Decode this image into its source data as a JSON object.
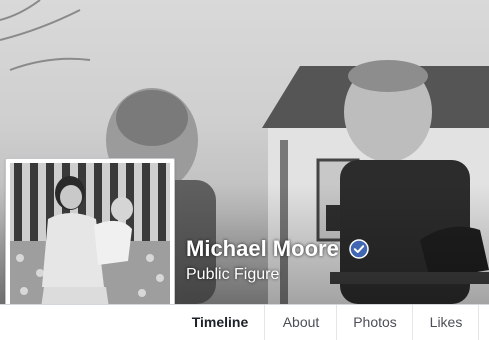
{
  "page": {
    "name": "Michael Moore",
    "category": "Public Figure",
    "verified": true,
    "accent_color": "#4267b2"
  },
  "cover": {
    "description_icon": "cover-photo-image"
  },
  "profile_picture": {
    "icon": "profile-photo-image"
  },
  "tabs": [
    {
      "label": "Timeline",
      "active": true
    },
    {
      "label": "About",
      "active": false
    },
    {
      "label": "Photos",
      "active": false
    },
    {
      "label": "Likes",
      "active": false
    }
  ]
}
